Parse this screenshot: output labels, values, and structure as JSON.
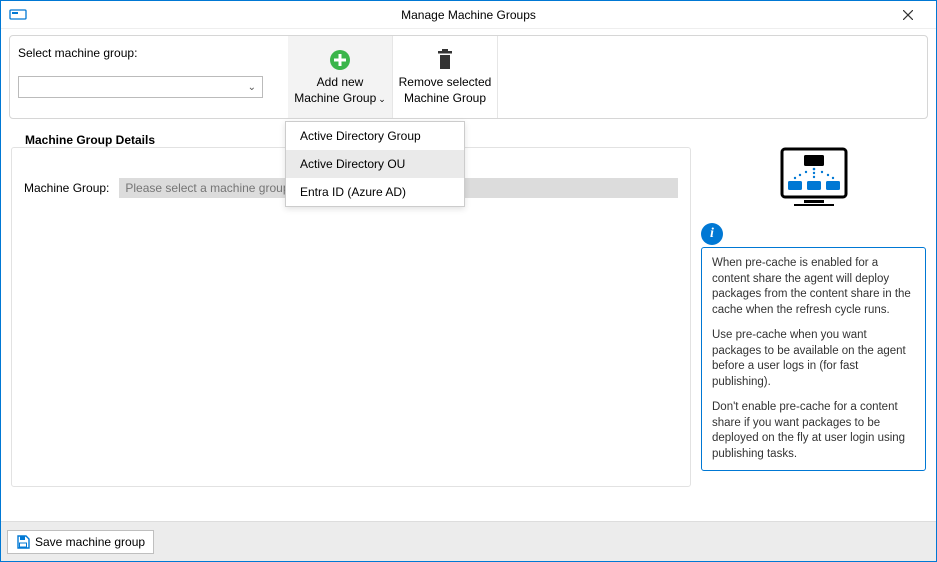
{
  "titlebar": {
    "title": "Manage Machine Groups"
  },
  "toolbar": {
    "select_label": "Select machine group:",
    "add_new_line1": "Add new",
    "add_new_line2": "Machine Group",
    "remove_line1": "Remove selected",
    "remove_line2": "Machine Group"
  },
  "addMenu": {
    "items": [
      {
        "label": "Active Directory Group"
      },
      {
        "label": "Active Directory OU"
      },
      {
        "label": "Entra ID (Azure AD)"
      }
    ],
    "hoveredIndex": 1
  },
  "details": {
    "legend": "Machine Group Details",
    "machine_group_label": "Machine Group:",
    "machine_group_placeholder": "Please select a machine group"
  },
  "info": {
    "p1": "When pre-cache is enabled for a content share the agent will deploy packages from the content share in the cache when the refresh cycle runs.",
    "p2": "Use pre-cache when you want packages to be available on the agent before a user logs in (for fast publishing).",
    "p3": "Don't enable pre-cache for a content share if you want packages to be deployed on the fly at user login using publishing tasks."
  },
  "footer": {
    "save_label": "Save machine group"
  }
}
